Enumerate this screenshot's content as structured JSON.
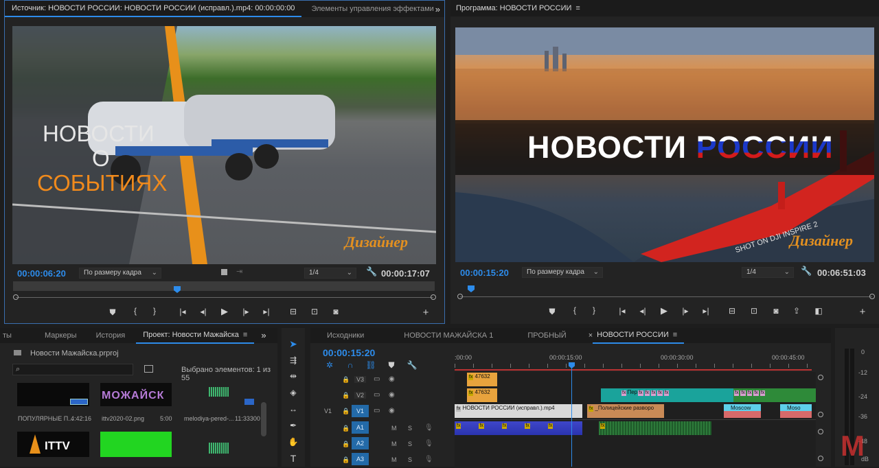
{
  "source": {
    "tabs": [
      "Источник: НОВОСТИ РОССИИ: НОВОСТИ РОССИИ (исправл.).mp4: 00:00:00:00",
      "Элементы управления эффектами"
    ],
    "overflow": "»",
    "overlay": {
      "line1": "НОВОСТИ",
      "line2": "О",
      "line3": "СОБЫТИЯХ",
      "brand": "Дизайнер"
    },
    "timecode": "00:00:06:20",
    "fit": "По размеру кадра",
    "res": "1/4",
    "duration": "00:00:17:07"
  },
  "program": {
    "title": "Программа: НОВОСТИ РОССИИ",
    "headline_a": "НОВОСТИ",
    "headline_b": "РОССИИ",
    "shot": "SHOT ON DJI INSPIRE 2",
    "brand": "Дизайнер",
    "timecode": "00:00:15:20",
    "fit": "По размеру кадра",
    "res": "1/4",
    "duration": "00:06:51:03"
  },
  "project": {
    "tabs": [
      "ты",
      "Маркеры",
      "История",
      "Проект: Новости Мажайска",
      "»"
    ],
    "filename": "Новости Мажайска.prproj",
    "selected": "Выбрано элементов: 1 из 55",
    "items": [
      {
        "name": "ПОПУЛЯРНЫЕ П...",
        "dur": "4:42:16"
      },
      {
        "name": "ittv2020-02.png",
        "dur": "5:00"
      },
      {
        "name": "melodiya-pered-...",
        "dur": "11:33300"
      }
    ],
    "thumb_text_1": "МОЖАЙСК",
    "thumb_text_2": "ITTV"
  },
  "timeline": {
    "tabs": [
      "Исходники",
      "НОВОСТИ МАЖАЙСКА 1",
      "ПРОБНЫЙ",
      "НОВОСТИ РОССИИ"
    ],
    "close": "×",
    "timecode": "00:00:15:20",
    "ruler": [
      ":00:00",
      "00:00:15:00",
      "00:00:30:00",
      "00:00:45:00"
    ],
    "tracks": [
      "V3",
      "V2",
      "V1",
      "A1",
      "A2",
      "A3"
    ],
    "src_v1": "V1",
    "clips": {
      "v3a": "47632",
      "v2a": "47632",
      "v2b": "Пер",
      "v1a": "НОВОСТИ РОССИИ (исправл.).mp4",
      "v1b": "_Полицейские развоpо",
      "v1c": "Moscow",
      "v1d": "Moso",
      "fx": "fx"
    },
    "m": "M",
    "s": "S"
  },
  "meter": {
    "labels": [
      "0",
      "-12",
      "-24",
      "-36",
      "-48",
      "dB"
    ],
    "logo": "M"
  }
}
